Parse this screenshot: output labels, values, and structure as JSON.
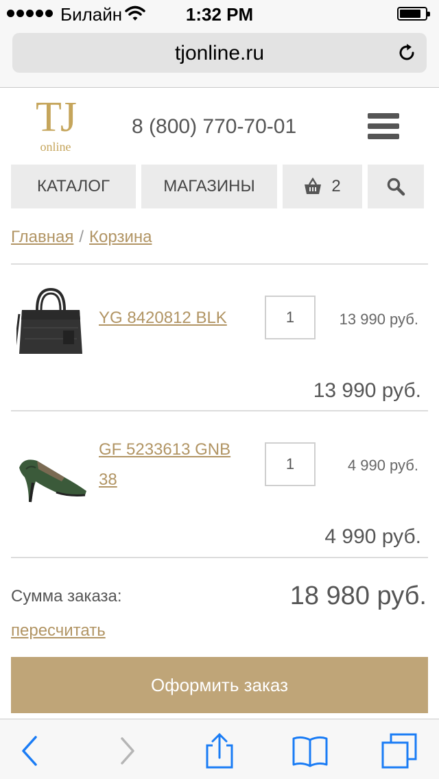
{
  "status_bar": {
    "carrier": "Билайн",
    "time": "1:32 PM"
  },
  "browser": {
    "url": "tjonline.ru"
  },
  "header": {
    "logo_text": "TJ",
    "logo_sub": "online",
    "phone": "8 (800) 770-70-01"
  },
  "nav": {
    "catalog": "КАТАЛОГ",
    "shops": "МАГАЗИНЫ",
    "cart_count": "2"
  },
  "breadcrumb": {
    "home": "Главная",
    "separator": "/",
    "current": "Корзина"
  },
  "cart": {
    "items": [
      {
        "name": "YG 8420812 BLK",
        "qty": "1",
        "unit_price": "13 990 руб.",
        "total": "13 990 руб."
      },
      {
        "name": "GF 5233613 GNB 38",
        "qty": "1",
        "unit_price": "4 990 руб.",
        "total": "4 990 руб."
      }
    ],
    "sum_label": "Сумма заказа:",
    "sum_value": "18 980 руб.",
    "recalc": "пересчитать",
    "checkout": "Оформить заказ"
  },
  "icons": {
    "signal": "signal-dots-icon",
    "wifi": "wifi-icon",
    "battery": "battery-icon",
    "reload": "reload-icon",
    "menu": "hamburger-menu-icon",
    "cart": "basket-icon",
    "search": "search-icon",
    "back": "back-arrow-icon",
    "forward": "forward-arrow-icon",
    "share": "share-icon",
    "bookmarks": "bookmarks-icon",
    "tabs": "tabs-icon"
  },
  "colors": {
    "accent": "#b19463",
    "button": "#bfa578",
    "ios_blue": "#1a7cf5"
  }
}
